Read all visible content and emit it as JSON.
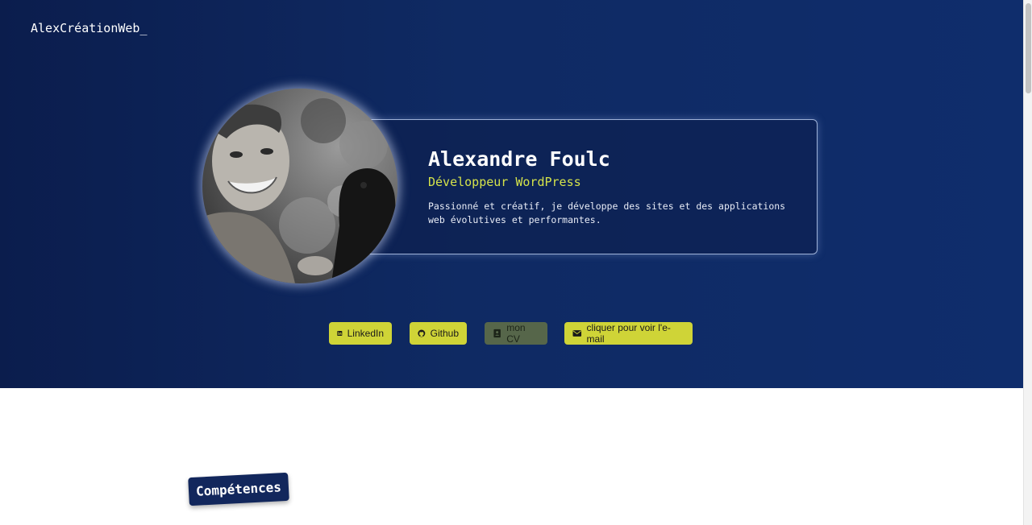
{
  "header": {
    "logo": "AlexCréationWeb_"
  },
  "profile": {
    "name": "Alexandre Foulc",
    "role": "Développeur WordPress",
    "description": "Passionné et créatif, je développe des sites et des applications web évolutives et performantes."
  },
  "actions": [
    {
      "label": "LinkedIn",
      "icon": "linkedin-icon"
    },
    {
      "label": "Github",
      "icon": "github-icon"
    },
    {
      "label": "mon CV",
      "icon": "contact-card-icon"
    },
    {
      "label": "cliquer pour voir l'e-mail",
      "icon": "envelope-icon"
    }
  ],
  "sections": {
    "skills_title": "Compétences"
  },
  "colors": {
    "hero_bg": "#0f2a63",
    "accent": "#cfd437",
    "accent_muted": "#56664a",
    "role_text": "#d5e34a",
    "badge_bg": "#12275c"
  }
}
